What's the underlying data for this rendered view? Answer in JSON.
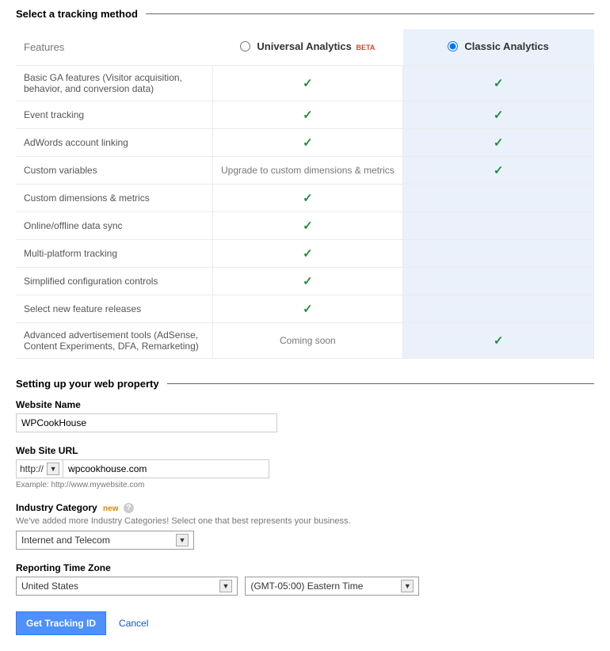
{
  "tracking": {
    "header": "Select a tracking method",
    "features_label": "Features",
    "universal_label": "Universal Analytics",
    "beta_label": "BETA",
    "classic_label": "Classic Analytics",
    "rows": [
      {
        "label": "Basic GA features (Visitor acquisition, behavior, and conversion data)",
        "ua": "check",
        "ca": "check"
      },
      {
        "label": "Event tracking",
        "ua": "check",
        "ca": "check"
      },
      {
        "label": "AdWords account linking",
        "ua": "check",
        "ca": "check"
      },
      {
        "label": "Custom variables",
        "ua": "Upgrade to custom dimensions & metrics",
        "ca": "check"
      },
      {
        "label": "Custom dimensions & metrics",
        "ua": "check",
        "ca": ""
      },
      {
        "label": "Online/offline data sync",
        "ua": "check",
        "ca": ""
      },
      {
        "label": "Multi-platform tracking",
        "ua": "check",
        "ca": ""
      },
      {
        "label": "Simplified configuration controls",
        "ua": "check",
        "ca": ""
      },
      {
        "label": "Select new feature releases",
        "ua": "check",
        "ca": ""
      },
      {
        "label": "Advanced advertisement tools (AdSense, Content Experiments, DFA, Remarketing)",
        "ua": "Coming soon",
        "ca": "check"
      }
    ]
  },
  "property": {
    "header": "Setting up your web property",
    "website_name_label": "Website Name",
    "website_name_value": "WPCookHouse",
    "website_url_label": "Web Site URL",
    "protocol": "http://",
    "website_url_value": "wpcookhouse.com",
    "url_hint": "Example: http://www.mywebsite.com",
    "industry_label": "Industry Category",
    "new_badge": "new",
    "industry_desc": "We've added more Industry Categories! Select one that best represents your business.",
    "industry_value": "Internet and Telecom",
    "tz_label": "Reporting Time Zone",
    "tz_country": "United States",
    "tz_value": "(GMT-05:00) Eastern Time"
  },
  "actions": {
    "submit": "Get Tracking ID",
    "cancel": "Cancel"
  }
}
